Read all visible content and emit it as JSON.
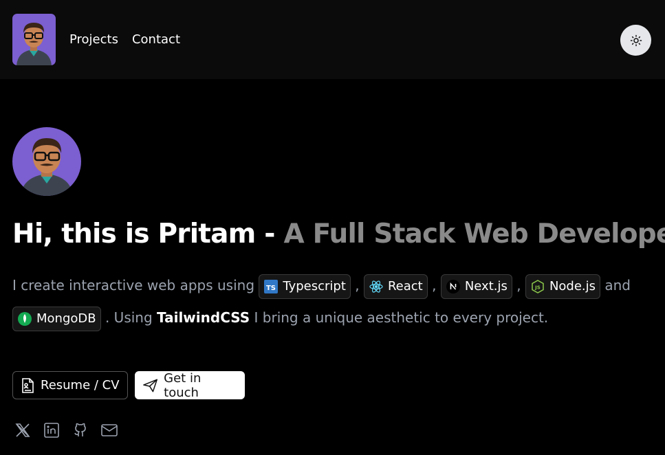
{
  "nav": {
    "links": [
      "Projects",
      "Contact"
    ],
    "theme_icon": "sun-icon"
  },
  "hero": {
    "headline_main": "Hi, this is Pritam -",
    "headline_muted": "A Full Stack Web Developer.",
    "intro_start": "I create interactive web apps using",
    "chips": [
      {
        "label": "Typescript",
        "icon": "typescript-icon",
        "color": "#3178c6"
      },
      {
        "label": "React",
        "icon": "react-icon",
        "color": "#61dafb"
      },
      {
        "label": "Next.js",
        "icon": "nextjs-icon",
        "color": "#ffffff"
      },
      {
        "label": "Node.js",
        "icon": "nodejs-icon",
        "color": "#8cc84b"
      },
      {
        "label": "MongoDB",
        "icon": "mongodb-icon",
        "color": "#13aa52"
      }
    ],
    "sep": ",",
    "and_text": "and",
    "using_text": ". Using",
    "tailwind": "TailwindCSS",
    "intro_end": "I bring a unique aesthetic to every project."
  },
  "buttons": {
    "resume": "Resume / CV",
    "contact": "Get in touch"
  },
  "socials": [
    "x-icon",
    "linkedin-icon",
    "github-icon",
    "mail-icon"
  ],
  "colors": {
    "background": "#000000",
    "navbar": "#0b0b0b",
    "avatar_bg": "#7c5fd0",
    "muted_text": "#8a8a8a"
  }
}
